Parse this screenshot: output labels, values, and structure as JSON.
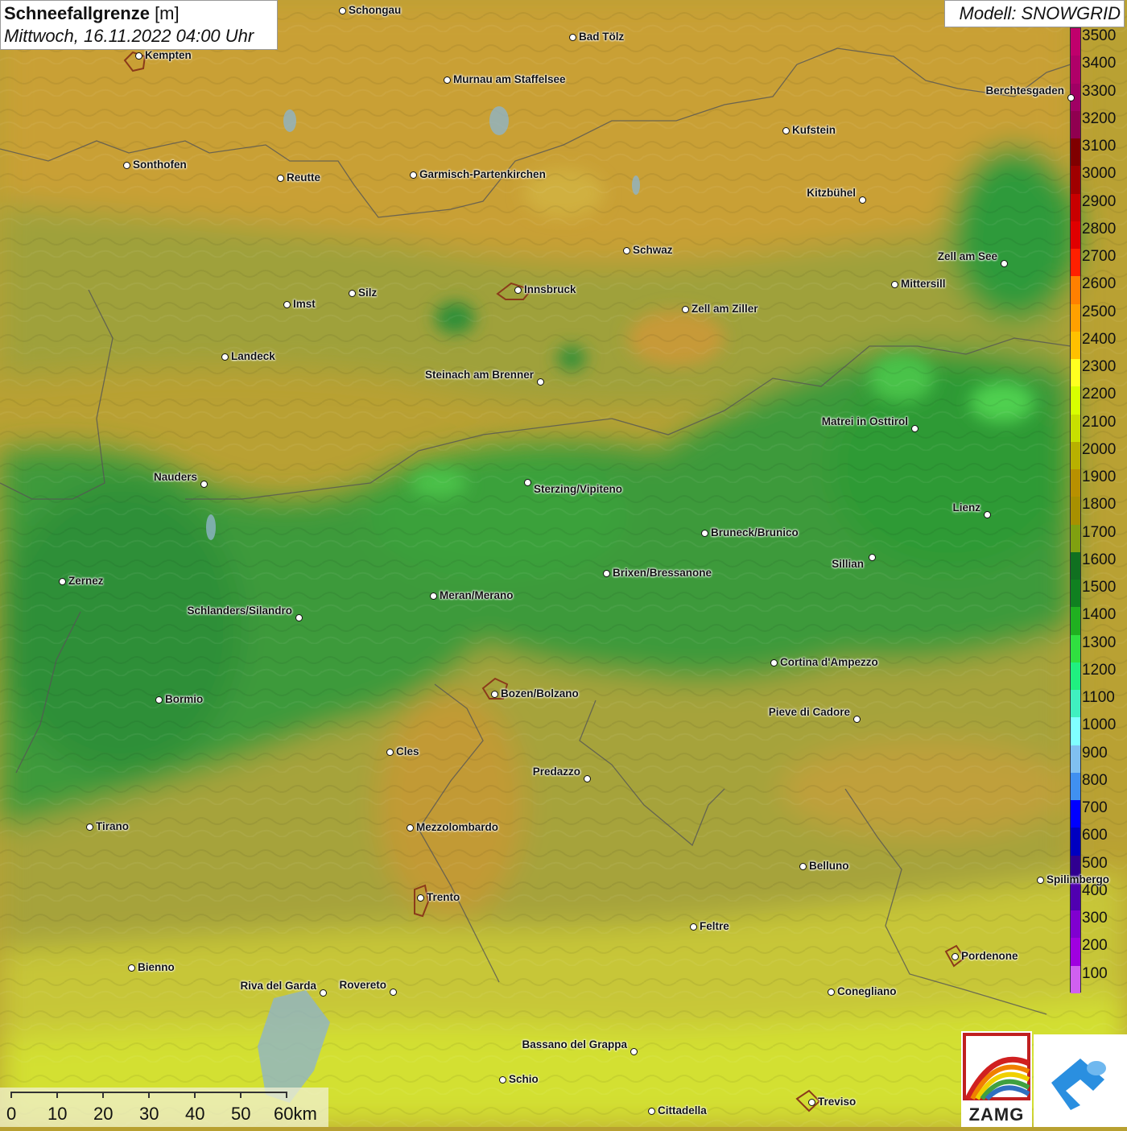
{
  "header": {
    "title_bold": "Schneefallgrenze",
    "title_unit": " [m]",
    "datetime": "Mittwoch, 16.11.2022 04:00 Uhr",
    "model": "Modell: SNOWGRID"
  },
  "legend": {
    "labels": [
      "3500",
      "3400",
      "3300",
      "3200",
      "3100",
      "3000",
      "2900",
      "2800",
      "2700",
      "2600",
      "2500",
      "2400",
      "2300",
      "2200",
      "2100",
      "2000",
      "1900",
      "1800",
      "1700",
      "1600",
      "1500",
      "1400",
      "1300",
      "1200",
      "1100",
      "1000",
      "900",
      "800",
      "700",
      "600",
      "500",
      "400",
      "300",
      "200",
      "100"
    ],
    "colors": [
      "#c0006c",
      "#b00068",
      "#a00064",
      "#900050",
      "#800000",
      "#a00000",
      "#c80000",
      "#e00000",
      "#ff2000",
      "#ff8000",
      "#ffa000",
      "#ffc000",
      "#ffff20",
      "#d8ff00",
      "#c8e000",
      "#b8b000",
      "#b89000",
      "#a89000",
      "#80a010",
      "#107020",
      "#108020",
      "#20b020",
      "#30e040",
      "#20f080",
      "#40f0c0",
      "#80ffff",
      "#80c0f0",
      "#4090f0",
      "#0000ff",
      "#0000c0",
      "#300090",
      "#5000b0",
      "#8000d0",
      "#a000e0",
      "#d060f0"
    ]
  },
  "cities": [
    {
      "name": "Schongau"
    },
    {
      "name": "Kempten"
    },
    {
      "name": "Bad Tölz"
    },
    {
      "name": "Murnau am Staffelsee"
    },
    {
      "name": "Berchtesgaden"
    },
    {
      "name": "Kufstein"
    },
    {
      "name": "Sonthofen"
    },
    {
      "name": "Reutte"
    },
    {
      "name": "Garmisch-Partenkirchen"
    },
    {
      "name": "Kitzbühel"
    },
    {
      "name": "Schwaz"
    },
    {
      "name": "Zell am See"
    },
    {
      "name": "Mittersill"
    },
    {
      "name": "Innsbruck"
    },
    {
      "name": "Silz"
    },
    {
      "name": "Imst"
    },
    {
      "name": "Zell am Ziller"
    },
    {
      "name": "Landeck"
    },
    {
      "name": "Steinach am Brenner"
    },
    {
      "name": "Matrei in Osttirol"
    },
    {
      "name": "Nauders"
    },
    {
      "name": "Sterzing/Vipiteno"
    },
    {
      "name": "Lienz"
    },
    {
      "name": "Bruneck/Brunico"
    },
    {
      "name": "Sillian"
    },
    {
      "name": "Zernez"
    },
    {
      "name": "Brixen/Bressanone"
    },
    {
      "name": "Meran/Merano"
    },
    {
      "name": "Schlanders/Silandro"
    },
    {
      "name": "Cortina d'Ampezzo"
    },
    {
      "name": "Bozen/Bolzano"
    },
    {
      "name": "Bormio"
    },
    {
      "name": "Pieve di Cadore"
    },
    {
      "name": "Cles"
    },
    {
      "name": "Predazzo"
    },
    {
      "name": "Tirano"
    },
    {
      "name": "Mezzolombardo"
    },
    {
      "name": "Belluno"
    },
    {
      "name": "Spilimbergo"
    },
    {
      "name": "Trento"
    },
    {
      "name": "Feltre"
    },
    {
      "name": "Pordenone"
    },
    {
      "name": "Bienno"
    },
    {
      "name": "Riva del Garda"
    },
    {
      "name": "Rovereto"
    },
    {
      "name": "Conegliano"
    },
    {
      "name": "Bassano del Grappa"
    },
    {
      "name": "Schio"
    },
    {
      "name": "Treviso"
    },
    {
      "name": "Cittadella"
    }
  ],
  "scale": {
    "labels": [
      "0",
      "10",
      "20",
      "30",
      "40",
      "50",
      "60km"
    ]
  },
  "logos": {
    "zamg": "ZAMG"
  }
}
